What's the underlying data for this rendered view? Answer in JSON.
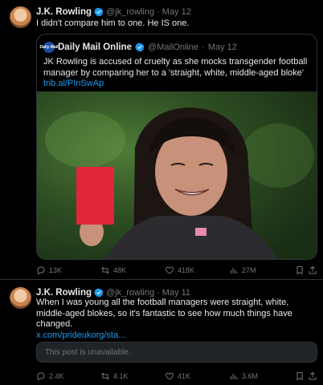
{
  "tweet1": {
    "author_name": "J.K. Rowling",
    "handle": "@jk_rowling",
    "separator": "·",
    "date": "May 12",
    "text": "I didn't compare him to one. He IS one.",
    "quote": {
      "logo_text": "Daily Mail",
      "author_name": "Daily Mail Online",
      "handle": "@MailOnline",
      "separator": "·",
      "date": "May 12",
      "text": "JK Rowling is accused of cruelty as she mocks transgender football manager by comparing her to a 'straight, white, middle-aged bloke'",
      "link": "trib.al/PInSwAp"
    },
    "stats": {
      "replies": "13K",
      "reposts": "48K",
      "likes": "418K",
      "views": "27M"
    }
  },
  "tweet2": {
    "author_name": "J.K. Rowling",
    "handle": "@jk_rowling",
    "separator": "·",
    "date": "May 11",
    "text": "When I was young all the football managers were straight, white, middle-aged blokes, so it's fantastic to see how much things have changed.",
    "link": "x.com/prideukorg/sta...",
    "unavailable_text": "This post is unavailable.",
    "stats": {
      "replies": "2.4K",
      "reposts": "4.1K",
      "likes": "41K",
      "views": "3.6M"
    }
  },
  "colors": {
    "background": "#000000",
    "text": "#e7e9ea",
    "muted": "#71767b",
    "accent": "#1d9bf0",
    "border": "#2f3336"
  },
  "icons": [
    "verified-badge-icon",
    "reply-icon",
    "repost-icon",
    "like-icon",
    "views-icon",
    "bookmark-icon",
    "share-icon"
  ]
}
